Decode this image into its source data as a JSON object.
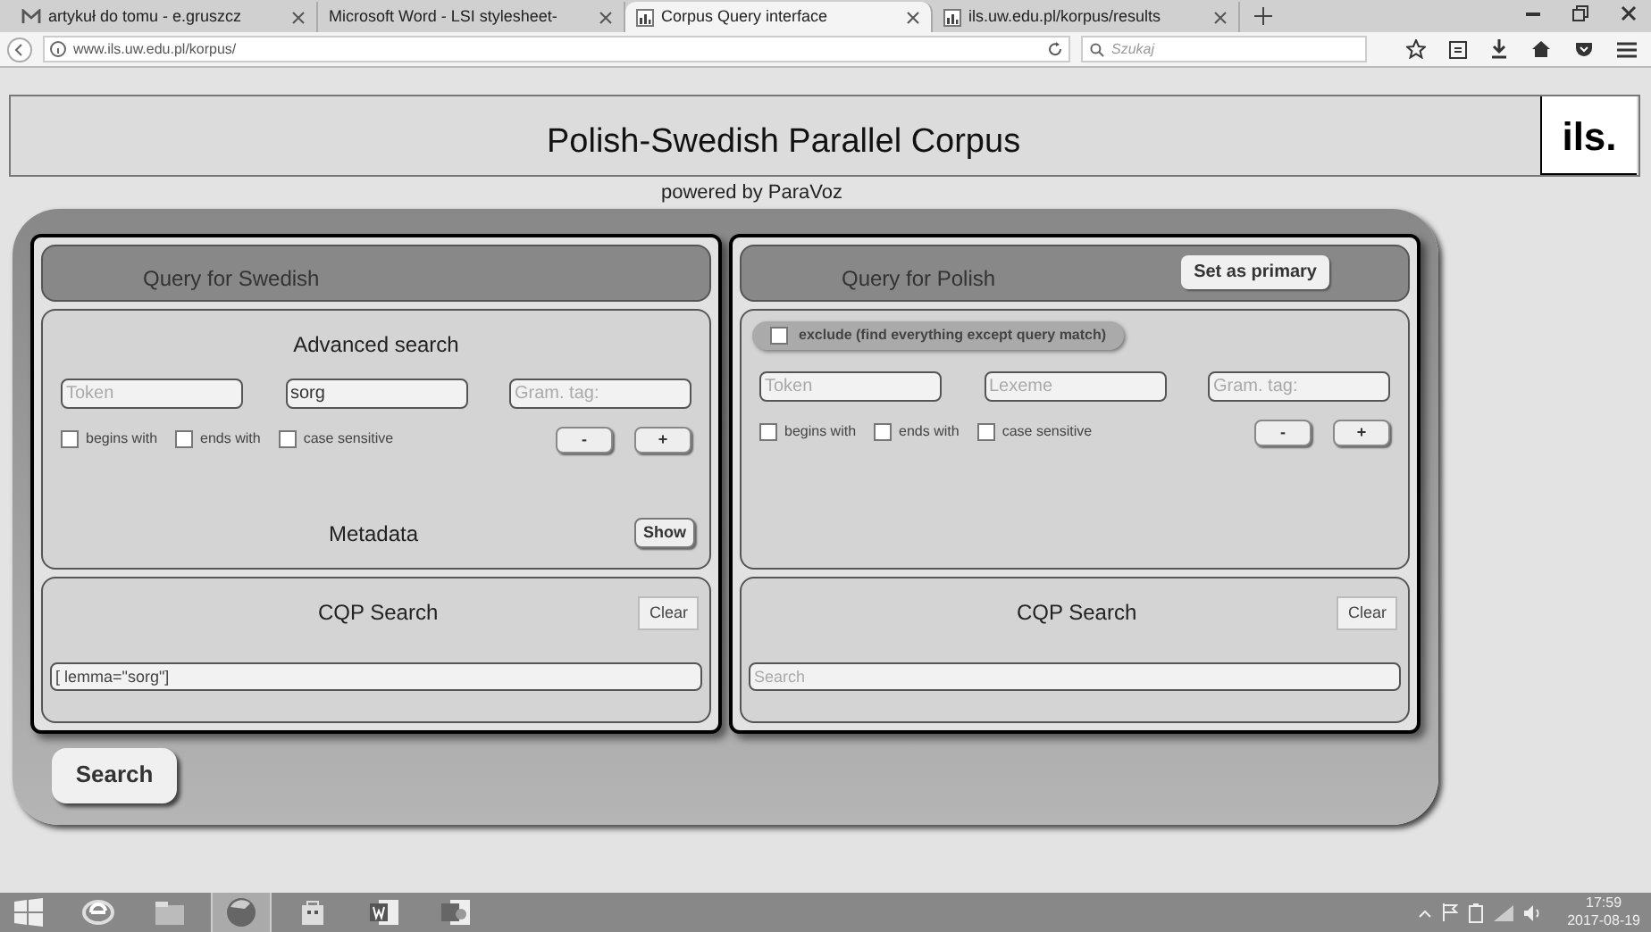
{
  "browser": {
    "tabs": [
      {
        "title": "artykuł do tomu - e.gruszcz",
        "kind": "mail",
        "selected": false
      },
      {
        "title": "Microsoft Word - LSI stylesheet-",
        "kind": "page",
        "selected": false
      },
      {
        "title": "Corpus Query interface",
        "kind": "site",
        "selected": true
      },
      {
        "title": "ils.uw.edu.pl/korpus/results",
        "kind": "site",
        "selected": false
      }
    ],
    "address": "www.ils.uw.edu.pl/korpus/",
    "search_placeholder": "Szukaj"
  },
  "header": {
    "title": "Polish-Swedish Parallel Corpus",
    "logo": "ils.",
    "subtitle": "powered by ParaVoz"
  },
  "panels": [
    {
      "title": "Query for Swedish",
      "section_title": "Advanced search",
      "fields": [
        {
          "placeholder": "Token"
        },
        {
          "value": "sorg"
        },
        {
          "placeholder": "Gram. tag:"
        }
      ],
      "checkboxes": [
        {
          "label": "begins with",
          "checked": false
        },
        {
          "label": "ends with",
          "checked": false
        },
        {
          "label": "case sensitive",
          "checked": false
        }
      ],
      "remove_button": "-",
      "add_button": "+",
      "metadata": {
        "label": "Metadata",
        "button": "Show"
      },
      "cqp": {
        "title": "CQP Search",
        "clear": "Clear",
        "value": "[ lemma=\"sorg\"]"
      }
    },
    {
      "title": "Query for Polish",
      "primary_button": "Set as primary",
      "exclude": {
        "label": "exclude (find everything except query match)",
        "checked": false
      },
      "fields": [
        {
          "placeholder": "Token"
        },
        {
          "placeholder": "Lexeme"
        },
        {
          "placeholder": "Gram. tag:"
        }
      ],
      "checkboxes": [
        {
          "label": "begins with",
          "checked": false
        },
        {
          "label": "ends with",
          "checked": false
        },
        {
          "label": "case sensitive",
          "checked": false
        }
      ],
      "remove_button": "-",
      "add_button": "+",
      "cqp": {
        "title": "CQP Search",
        "clear": "Clear",
        "placeholder": "Search"
      }
    }
  ],
  "search_button": "Search",
  "taskbar": {
    "apps": [
      {
        "kind": "ie",
        "selected": false
      },
      {
        "kind": "folder",
        "selected": false
      },
      {
        "kind": "browser",
        "selected": true
      },
      {
        "kind": "store",
        "selected": false
      },
      {
        "kind": "word",
        "selected": false
      },
      {
        "kind": "slides",
        "selected": false
      }
    ],
    "time": "17:59",
    "date": "2017-08-19"
  }
}
